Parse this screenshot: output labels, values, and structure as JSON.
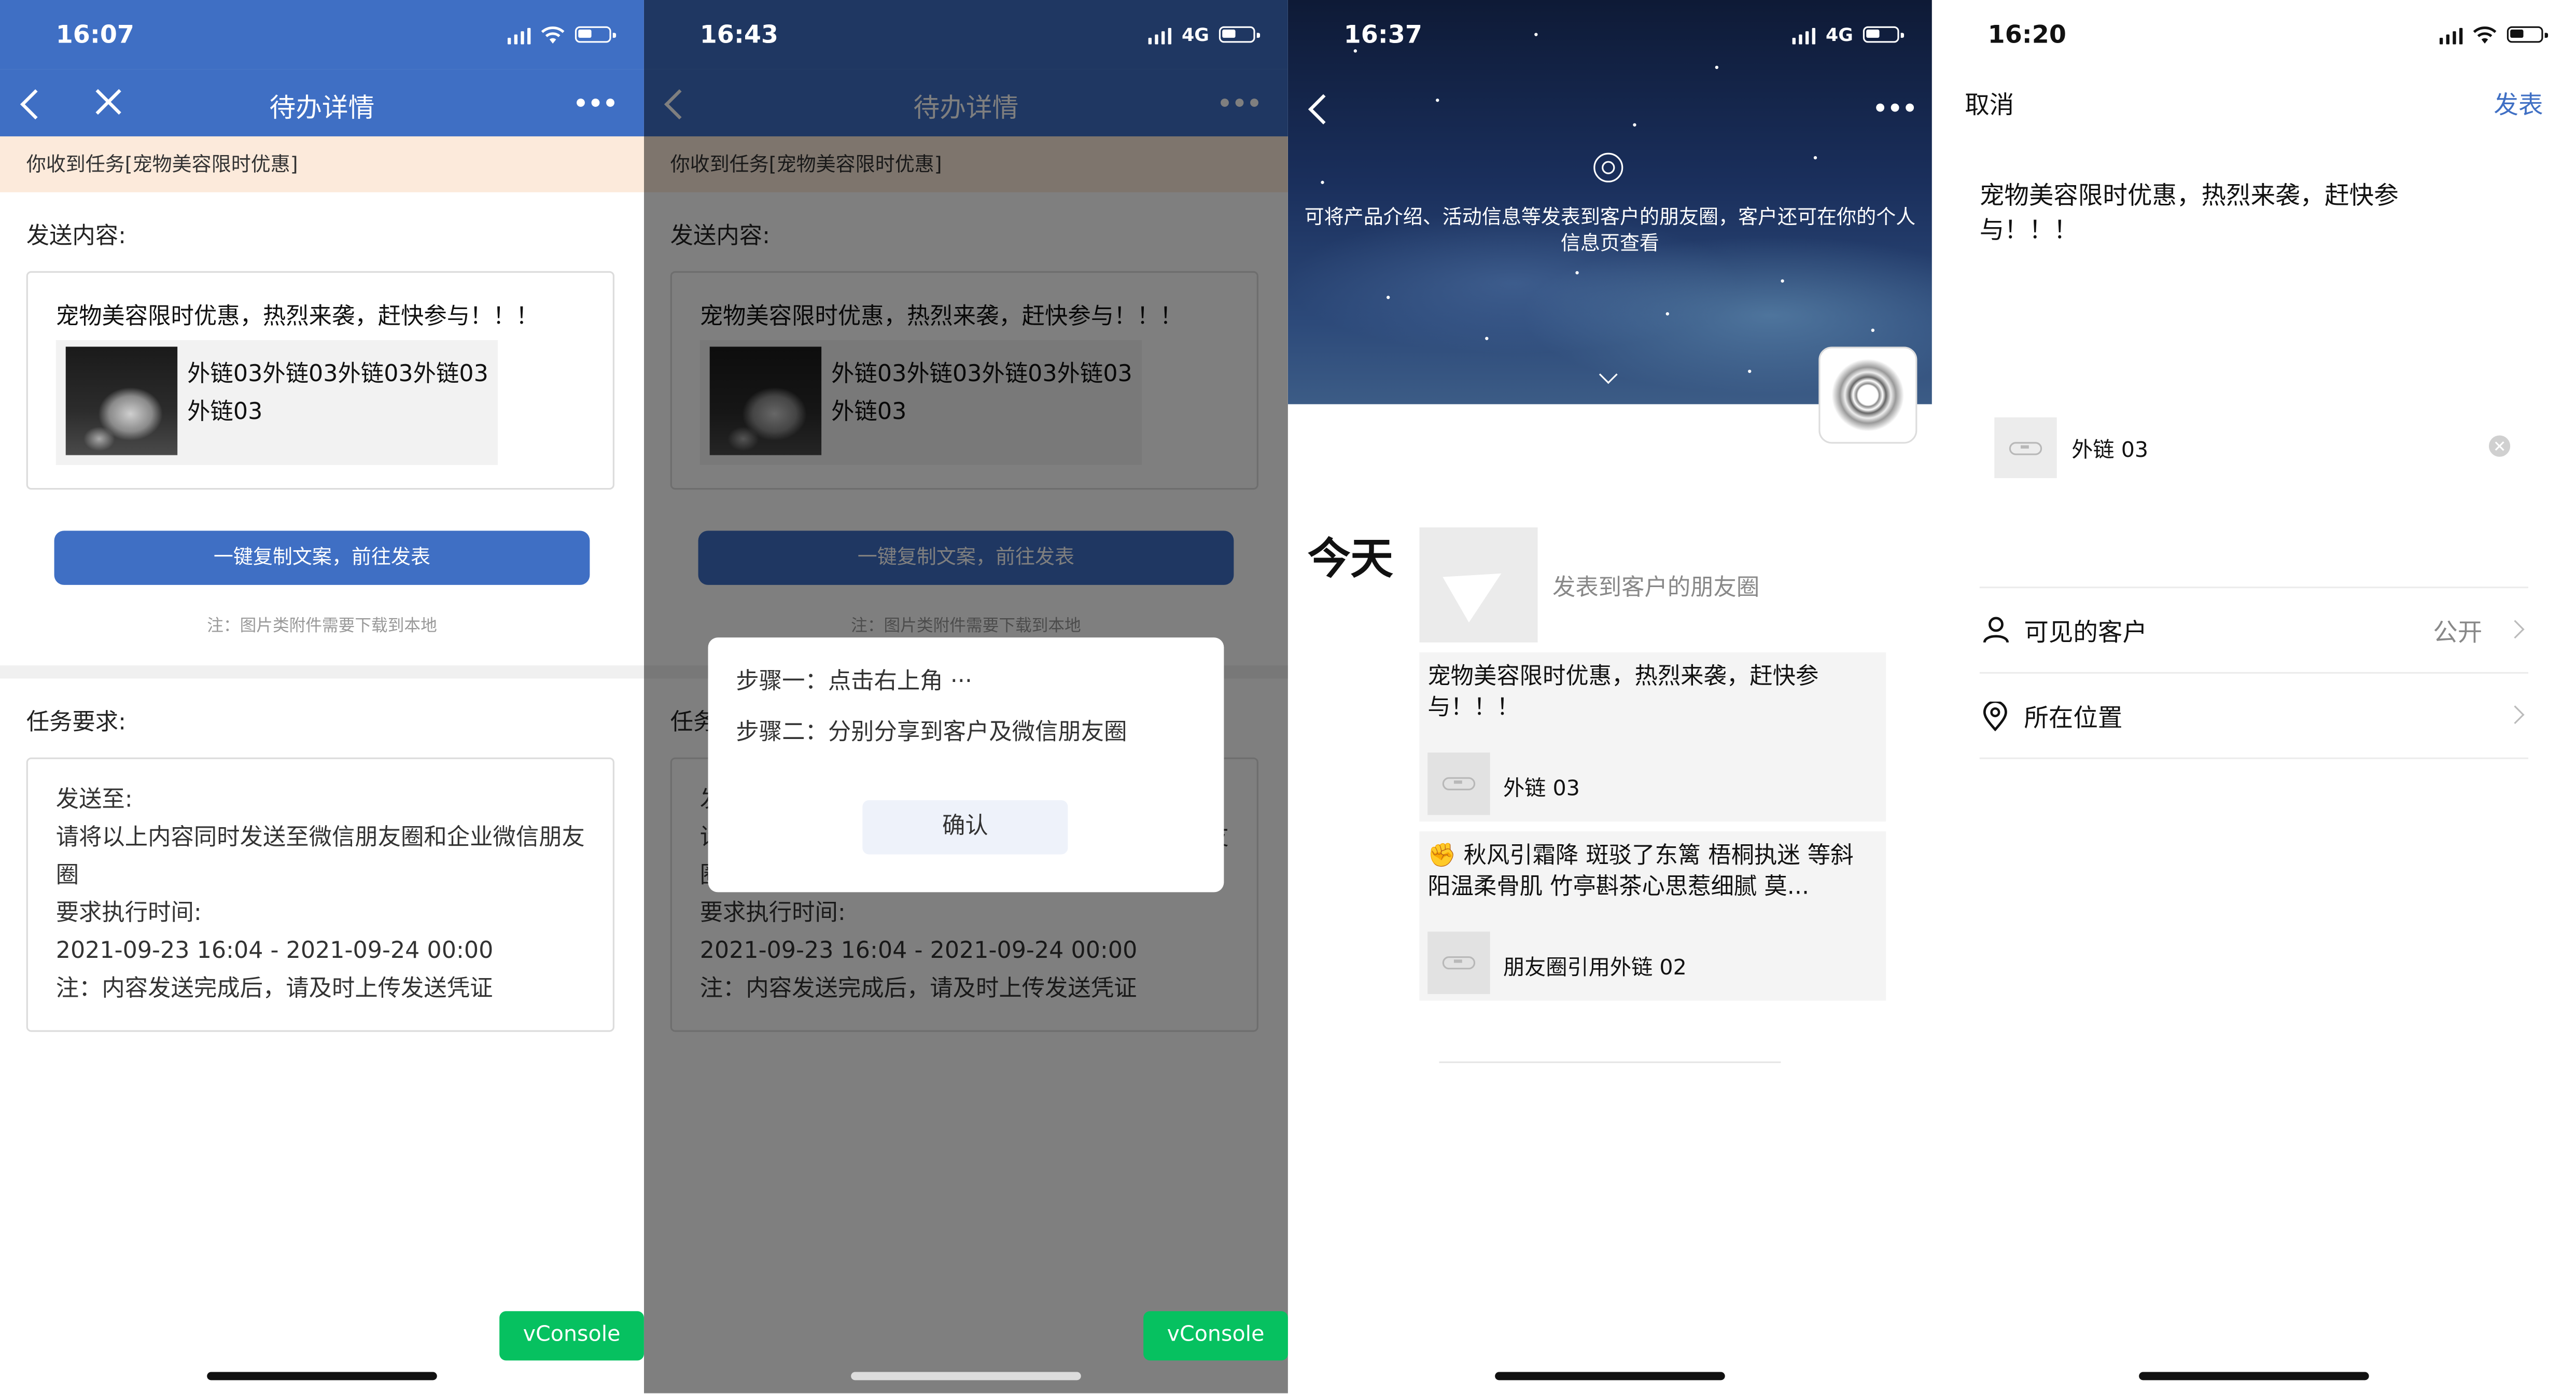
{
  "screen1": {
    "time": "16:07",
    "title": "待办详情",
    "notice": "你收到任务[宠物美容限时优惠]",
    "send_label": "发送内容:",
    "message": "宠物美容限时优惠，热烈来袭，赶快参与！！！",
    "link_title": "外链03外链03外链03外链03外链03",
    "copy_button": "一键复制文案，前往发表",
    "note": "注：图片类附件需要下载到本地",
    "task_label": "任务要求:",
    "req": [
      "发送至:",
      "请将以上内容同时发送至微信朋友圈和企业微信朋友圈",
      "要求执行时间:",
      "2021-09-23 16:04 - 2021-09-24 00:00",
      "注：内容发送完成后，请及时上传发送凭证"
    ],
    "vconsole": "vConsole"
  },
  "screen2": {
    "time": "16:43",
    "network": "4G",
    "title": "待办详情",
    "dialog": {
      "step1": "步骤一：点击右上角 ···",
      "step2": "步骤二：分别分享到客户及微信朋友圈",
      "confirm": "确认"
    },
    "vconsole": "vConsole"
  },
  "screen3": {
    "time": "16:37",
    "network": "4G",
    "banner": "可将产品介绍、活动信息等发表到客户的朋友圈，客户还可在你的个人信息页查看",
    "today": "今天",
    "send_to_moments": "发表到客户的朋友圈",
    "post1_text": "宠物美容限时优惠，热烈来袭，赶快参与！！！",
    "post1_link": "外链 03",
    "post2_text": "✊ 秋风引霜降 斑驳了东篱 梧桐执迷 等斜阳温柔骨肌 竹亭斟茶心思惹细腻 莫...",
    "post2_link": "朋友圈引用外链 02"
  },
  "screen4": {
    "time": "16:20",
    "cancel": "取消",
    "publish": "发表",
    "text": "宠物美容限时优惠，热烈来袭，赶快参与！！！",
    "attachment": "外链 03",
    "visible_label": "可见的客户",
    "visible_value": "公开",
    "location_label": "所在位置"
  }
}
